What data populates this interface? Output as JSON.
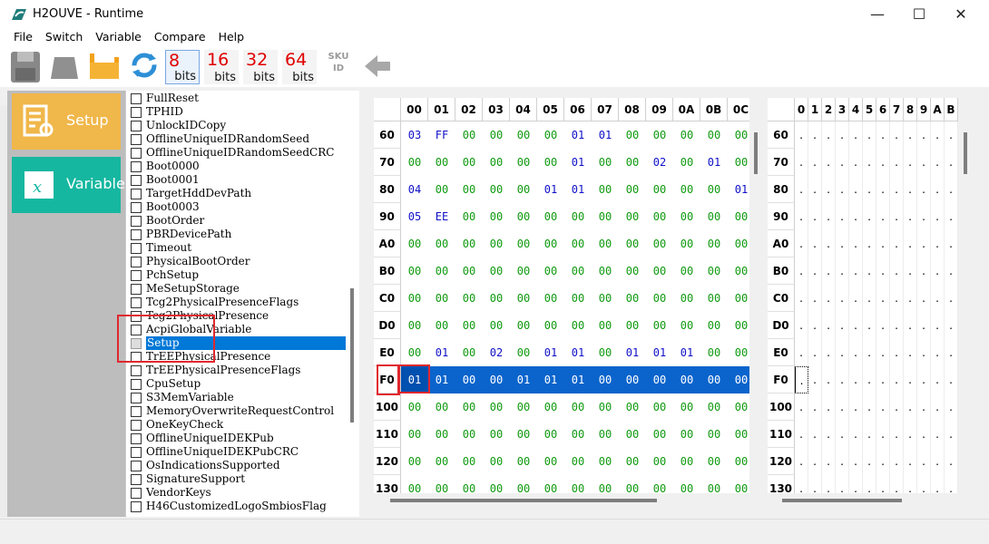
{
  "window": {
    "title": "H2OUVE - Runtime",
    "minimize": "—",
    "maximize": "☐",
    "close": "✕"
  },
  "menu": [
    "File",
    "Switch",
    "Variable",
    "Compare",
    "Help"
  ],
  "toolbar": {
    "bits": [
      {
        "num": "8",
        "label": "bits"
      },
      {
        "num": "16",
        "label": "bits"
      },
      {
        "num": "32",
        "label": "bits"
      },
      {
        "num": "64",
        "label": "bits"
      }
    ],
    "sku_line1": "SKU",
    "sku_line2": "ID"
  },
  "left_buttons": {
    "setup": "Setup",
    "variable": "Variable"
  },
  "variables": [
    "FullReset",
    "TPHID",
    "UnlockIDCopy",
    "OfflineUniqueIDRandomSeed",
    "OfflineUniqueIDRandomSeedCRC",
    "Boot0000",
    "Boot0001",
    "TargetHddDevPath",
    "Boot0003",
    "BootOrder",
    "PBRDevicePath",
    "Timeout",
    "PhysicalBootOrder",
    "PchSetup",
    "MeSetupStorage",
    "Tcg2PhysicalPresenceFlags",
    "Tcg2PhysicalPresence",
    "AcpiGlobalVariable",
    "Setup",
    "TrEEPhysicalPresence",
    "TrEEPhysicalPresenceFlags",
    "CpuSetup",
    "S3MemVariable",
    "MemoryOverwriteRequestControl",
    "OneKeyCheck",
    "OfflineUniqueIDEKPub",
    "OfflineUniqueIDEKPubCRC",
    "OsIndicationsSupported",
    "SignatureSupport",
    "VendorKeys",
    "H46CustomizedLogoSmbiosFlag"
  ],
  "selected_variable": "Setup",
  "hex": {
    "columns": [
      "00",
      "01",
      "02",
      "03",
      "04",
      "05",
      "06",
      "07",
      "08",
      "09",
      "0A",
      "0B",
      "0C"
    ],
    "selected_row": "F0",
    "rows": [
      {
        "addr": "60",
        "cells": [
          "03",
          "FF",
          "00",
          "00",
          "00",
          "00",
          "01",
          "01",
          "00",
          "00",
          "00",
          "00",
          "00"
        ]
      },
      {
        "addr": "70",
        "cells": [
          "00",
          "00",
          "00",
          "00",
          "00",
          "00",
          "01",
          "00",
          "00",
          "02",
          "00",
          "01",
          "00"
        ]
      },
      {
        "addr": "80",
        "cells": [
          "04",
          "00",
          "00",
          "00",
          "00",
          "01",
          "01",
          "00",
          "00",
          "00",
          "00",
          "00",
          "01"
        ]
      },
      {
        "addr": "90",
        "cells": [
          "05",
          "EE",
          "00",
          "00",
          "00",
          "00",
          "00",
          "00",
          "00",
          "00",
          "00",
          "00",
          "00"
        ]
      },
      {
        "addr": "A0",
        "cells": [
          "00",
          "00",
          "00",
          "00",
          "00",
          "00",
          "00",
          "00",
          "00",
          "00",
          "00",
          "00",
          "00"
        ]
      },
      {
        "addr": "B0",
        "cells": [
          "00",
          "00",
          "00",
          "00",
          "00",
          "00",
          "00",
          "00",
          "00",
          "00",
          "00",
          "00",
          "00"
        ]
      },
      {
        "addr": "C0",
        "cells": [
          "00",
          "00",
          "00",
          "00",
          "00",
          "00",
          "00",
          "00",
          "00",
          "00",
          "00",
          "00",
          "00"
        ]
      },
      {
        "addr": "D0",
        "cells": [
          "00",
          "00",
          "00",
          "00",
          "00",
          "00",
          "00",
          "00",
          "00",
          "00",
          "00",
          "00",
          "00"
        ]
      },
      {
        "addr": "E0",
        "cells": [
          "00",
          "01",
          "00",
          "02",
          "00",
          "01",
          "01",
          "00",
          "01",
          "01",
          "01",
          "00",
          "00"
        ]
      },
      {
        "addr": "F0",
        "cells": [
          "01",
          "01",
          "00",
          "00",
          "01",
          "01",
          "01",
          "00",
          "00",
          "00",
          "00",
          "00",
          "00"
        ]
      },
      {
        "addr": "100",
        "cells": [
          "00",
          "00",
          "00",
          "00",
          "00",
          "00",
          "00",
          "00",
          "00",
          "00",
          "00",
          "00",
          "00"
        ]
      },
      {
        "addr": "110",
        "cells": [
          "00",
          "00",
          "00",
          "00",
          "00",
          "00",
          "00",
          "00",
          "00",
          "00",
          "00",
          "00",
          "00"
        ]
      },
      {
        "addr": "120",
        "cells": [
          "00",
          "00",
          "00",
          "00",
          "00",
          "00",
          "00",
          "00",
          "00",
          "00",
          "00",
          "00",
          "00"
        ]
      },
      {
        "addr": "130",
        "cells": [
          "00",
          "00",
          "00",
          "00",
          "00",
          "00",
          "00",
          "00",
          "00",
          "00",
          "00",
          "00",
          "00"
        ]
      }
    ]
  },
  "ascii": {
    "columns": [
      "0",
      "1",
      "2",
      "3",
      "4",
      "5",
      "6",
      "7",
      "8",
      "9",
      "A",
      "B"
    ],
    "rows": [
      "60",
      "70",
      "80",
      "90",
      "A0",
      "B0",
      "C0",
      "D0",
      "E0",
      "F0",
      "100",
      "110",
      "120",
      "130"
    ],
    "dot": "."
  },
  "colors": {
    "accent": "#0078d7",
    "setup": "#f0b74a",
    "variable": "#16b7a0",
    "zero": "#109a10",
    "nonzero": "#1010c8",
    "highlight": "#e0282e"
  }
}
